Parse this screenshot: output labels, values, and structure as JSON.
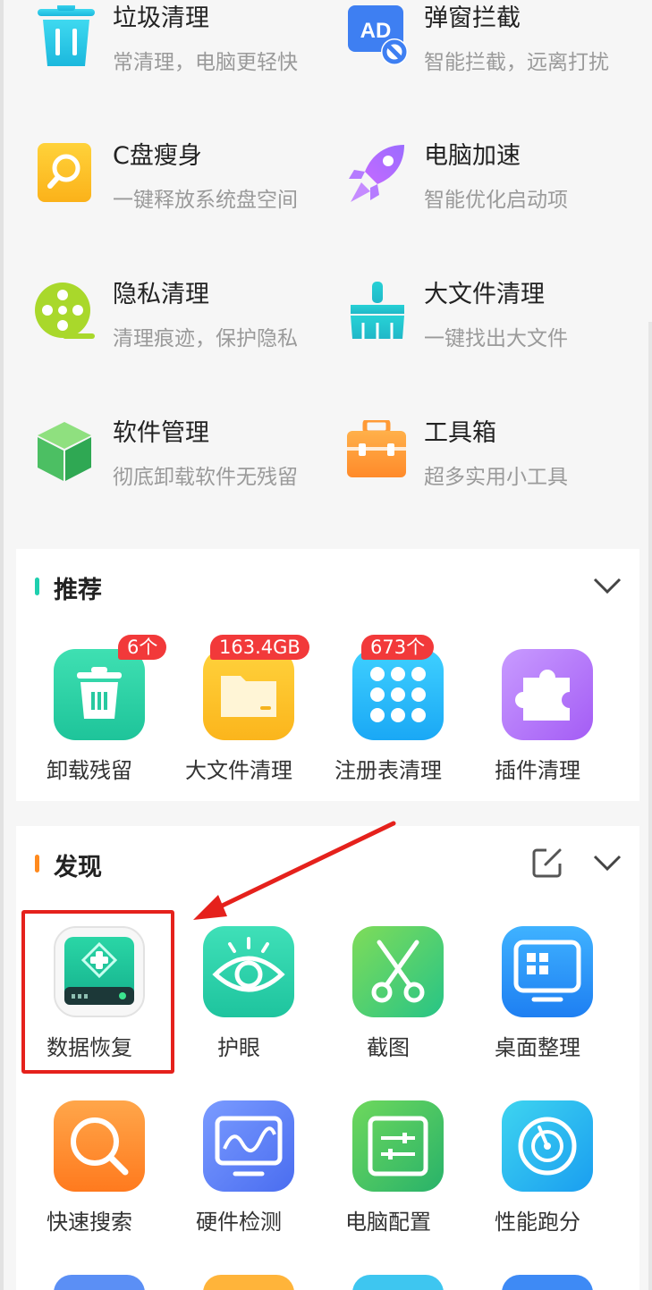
{
  "tools": [
    {
      "title": "垃圾清理",
      "desc": "常清理，电脑更轻快",
      "icon": "trash-icon"
    },
    {
      "title": "弹窗拦截",
      "desc": "智能拦截，远离打扰",
      "icon": "ad-block-icon"
    },
    {
      "title": "C盘瘦身",
      "desc": "一键释放系统盘空间",
      "icon": "disk-search-icon"
    },
    {
      "title": "电脑加速",
      "desc": "智能优化启动项",
      "icon": "rocket-icon"
    },
    {
      "title": "隐私清理",
      "desc": "清理痕迹，保护隐私",
      "icon": "film-reel-icon"
    },
    {
      "title": "大文件清理",
      "desc": "一键找出大文件",
      "icon": "broom-icon"
    },
    {
      "title": "软件管理",
      "desc": "彻底卸载软件无残留",
      "icon": "cube-icon"
    },
    {
      "title": "工具箱",
      "desc": "超多实用小工具",
      "icon": "toolbox-icon"
    }
  ],
  "recommend": {
    "title": "推荐",
    "accent": "#1ecfae",
    "items": [
      {
        "label": "卸载残留",
        "badge": "6个",
        "icon": "uninstall-trash-icon"
      },
      {
        "label": "大文件清理",
        "badge": "163.4GB",
        "icon": "folder-icon"
      },
      {
        "label": "注册表清理",
        "badge": "673个",
        "icon": "registry-grid-icon"
      },
      {
        "label": "插件清理",
        "badge": "",
        "icon": "puzzle-icon"
      }
    ]
  },
  "discover": {
    "title": "发现",
    "accent": "#ff8a1e",
    "items": [
      {
        "label": "数据恢复",
        "icon": "data-recovery-drive-icon"
      },
      {
        "label": "护眼",
        "icon": "eye-icon"
      },
      {
        "label": "截图",
        "icon": "scissors-icon"
      },
      {
        "label": "桌面整理",
        "icon": "desktop-grid-icon"
      },
      {
        "label": "快速搜索",
        "icon": "magnifier-icon"
      },
      {
        "label": "硬件检测",
        "icon": "monitor-wave-icon"
      },
      {
        "label": "电脑配置",
        "icon": "settings-panel-icon"
      },
      {
        "label": "性能跑分",
        "icon": "gauge-icon"
      }
    ]
  },
  "colors": {
    "highlight": "#e5211c",
    "badge": "#f2393a"
  }
}
